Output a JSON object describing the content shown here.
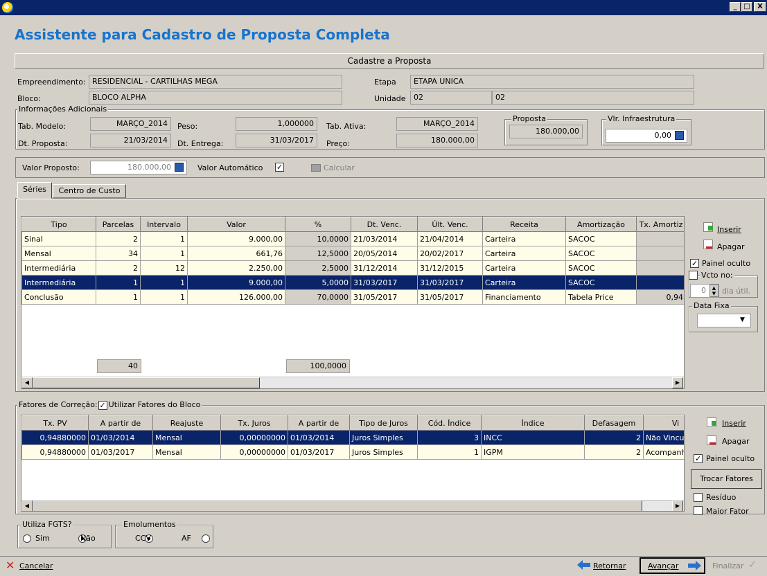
{
  "window": {
    "title": "Assistente para Cadastro de Proposta Completa",
    "controls": [
      "_",
      "□",
      "X"
    ]
  },
  "section_header": "Cadastre a Proposta",
  "info": {
    "empreendimento_label": "Empreendimento:",
    "empreendimento": "RESIDENCIAL - CARTILHAS MEGA",
    "etapa_label": "Etapa",
    "etapa": "ETAPA UNICA",
    "bloco_label": "Bloco:",
    "bloco": "BLOCO ALPHA",
    "unidade_label": "Unidade",
    "unidade": "02",
    "unidade2": "02"
  },
  "adicionais": {
    "title": "Informações Adicionais",
    "tab_modelo_label": "Tab. Modelo:",
    "tab_modelo": "MARÇO_2014",
    "peso_label": "Peso:",
    "peso": "1,000000",
    "tab_ativa_label": "Tab. Ativa:",
    "tab_ativa": "MARÇO_2014",
    "dt_proposta_label": "Dt. Proposta:",
    "dt_proposta": "21/03/2014",
    "dt_entrega_label": "Dt. Entrega:",
    "dt_entrega": "31/03/2017",
    "preco_label": "Preço:",
    "preco": "180.000,00",
    "proposta_title": "Proposta",
    "proposta": "180.000,00",
    "infra_title": "Vlr. Infraestrutura",
    "infra": "0,00"
  },
  "valor": {
    "label": "Valor Proposto:",
    "value": "180.000,00",
    "auto_label": "Valor Automático",
    "auto_checked": "✓",
    "calcular": "Calcular"
  },
  "tabs": [
    "Séries",
    "Centro de Custo"
  ],
  "series": {
    "headers": [
      "Tipo",
      "Parcelas",
      "Intervalo",
      "Valor",
      "%",
      "Dt. Venc.",
      "Últ. Venc.",
      "Receita",
      "Amortização",
      "Tx. Amortiz"
    ],
    "rows": [
      [
        "Sinal",
        "2",
        "1",
        "9.000,00",
        "10,0000",
        "21/03/2014",
        "21/04/2014",
        "Carteira",
        "SACOC",
        ""
      ],
      [
        "Mensal",
        "34",
        "1",
        "661,76",
        "12,5000",
        "20/05/2014",
        "20/02/2017",
        "Carteira",
        "SACOC",
        ""
      ],
      [
        "Intermediária",
        "2",
        "12",
        "2.250,00",
        "2,5000",
        "31/12/2014",
        "31/12/2015",
        "Carteira",
        "SACOC",
        ""
      ],
      [
        "Intermediária",
        "1",
        "1",
        "9.000,00",
        "5,0000",
        "31/03/2017",
        "31/03/2017",
        "Carteira",
        "SACOC",
        ""
      ],
      [
        "Conclusão",
        "1",
        "1",
        "126.000,00",
        "70,0000",
        "31/05/2017",
        "31/05/2017",
        "Financiamento",
        "Tabela Price",
        "0,94"
      ]
    ],
    "selected_row": 3,
    "total_parcelas": "40",
    "total_pct": "100,0000",
    "side": {
      "inserir": "Inserir",
      "apagar": "Apagar",
      "painel_oculto": "Painel oculto",
      "vcto_title": "Vcto no:",
      "vcto_value": "0",
      "dia_util": "dia útil.",
      "data_fixa_title": "Data Fixa"
    }
  },
  "fatores": {
    "title": "Fatores de Correção:",
    "utilizar_label": "Utilizar Fatores do Bloco",
    "headers": [
      "Tx. PV",
      "A partir de",
      "Reajuste",
      "Tx. Juros",
      "A partir de",
      "Tipo de Juros",
      "Cód. Índice",
      "Índice",
      "Defasagem",
      "Vi"
    ],
    "rows": [
      [
        "0,94880000",
        "01/03/2014",
        "Mensal",
        "0,00000000",
        "01/03/2014",
        "Juros Simples",
        "3",
        "INCC",
        "2",
        "Não Vincul"
      ],
      [
        "0,94880000",
        "01/03/2017",
        "Mensal",
        "0,00000000",
        "01/03/2017",
        "Juros Simples",
        "1",
        "IGPM",
        "2",
        "Acompanh"
      ]
    ],
    "side": {
      "inserir": "Inserir",
      "apagar": "Apagar",
      "painel_oculto": "Painel oculto",
      "trocar": "Trocar Fatores",
      "residuo": "Resíduo",
      "maior_fator": "Maior Fator"
    }
  },
  "fgts": {
    "title": "Utiliza FGTS?",
    "sim": "Sim",
    "nao": "Não"
  },
  "emolumentos": {
    "title": "Emolumentos",
    "ccv": "CCV",
    "af": "AF"
  },
  "footer": {
    "cancelar": "Cancelar",
    "retornar": "Retornar",
    "avancar": "Avançar",
    "finalizar": "Finalizar"
  }
}
